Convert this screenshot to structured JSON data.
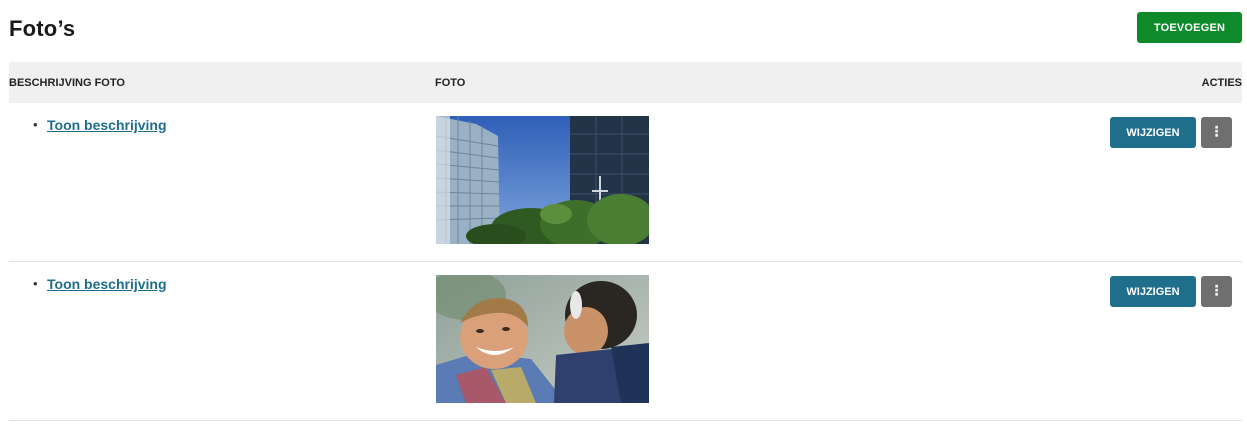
{
  "page": {
    "title": "Foto’s"
  },
  "toolbar": {
    "add_label": "TOEVOEGEN"
  },
  "table": {
    "headers": {
      "description": "BESCHRIJVING FOTO",
      "photo": "FOTO",
      "actions": "ACTIES"
    },
    "rows": [
      {
        "description_link": "Toon beschrijving",
        "photo_icon": "building-photo",
        "edit_label": "WIJZIGEN",
        "more_label": "⋮"
      },
      {
        "description_link": "Toon beschrijving",
        "photo_icon": "people-photo",
        "edit_label": "WIJZIGEN",
        "more_label": "⋮"
      }
    ]
  },
  "colors": {
    "add_button": "#0f8a2a",
    "edit_button": "#1f6e8c",
    "more_button": "#6f6f6f",
    "link": "#1f6e8c",
    "header_bg": "#f0f0f0"
  }
}
